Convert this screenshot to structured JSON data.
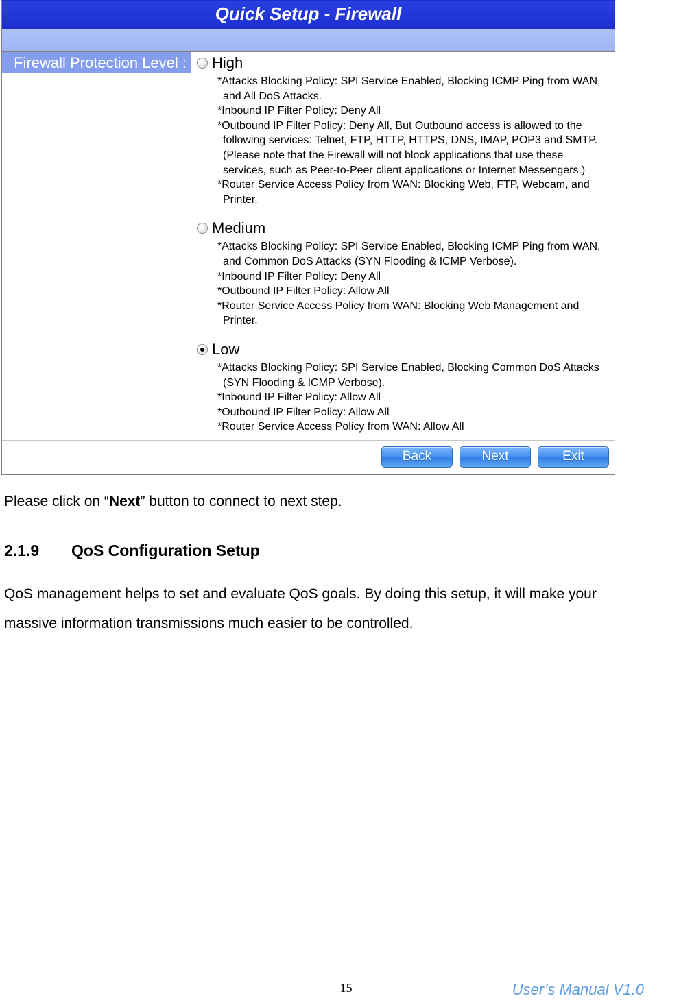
{
  "panel": {
    "title": "Quick Setup - Firewall",
    "label": "Firewall Protection Level :",
    "selected": "low",
    "options": {
      "high": {
        "label": "High",
        "descriptions": [
          "Attacks Blocking Policy: SPI Service Enabled, Blocking ICMP Ping from WAN, and All DoS Attacks.",
          "Inbound IP Filter Policy: Deny All",
          "Outbound IP Filter Policy: Deny All, But Outbound access is allowed to the following services: Telnet, FTP, HTTP, HTTPS, DNS, IMAP, POP3 and SMTP. (Please note that the Firewall will not block applications that use these services, such as Peer-to-Peer client applications or Internet Messengers.)",
          "Router Service Access Policy from WAN: Blocking Web, FTP, Webcam, and Printer."
        ]
      },
      "medium": {
        "label": "Medium",
        "descriptions": [
          "Attacks Blocking Policy: SPI Service Enabled, Blocking ICMP Ping from WAN, and Common DoS Attacks (SYN Flooding & ICMP Verbose).",
          "Inbound IP Filter Policy: Deny All",
          "Outbound IP Filter Policy: Allow All",
          "Router Service Access Policy from WAN: Blocking Web Management and Printer."
        ]
      },
      "low": {
        "label": "Low",
        "descriptions": [
          "Attacks Blocking Policy: SPI Service Enabled, Blocking Common DoS Attacks (SYN Flooding & ICMP Verbose).",
          "Inbound IP Filter Policy: Allow All",
          "Outbound IP Filter Policy: Allow All",
          "Router Service Access Policy from WAN: Allow All"
        ]
      }
    },
    "buttons": {
      "back": "Back",
      "next": "Next",
      "exit": "Exit"
    }
  },
  "doc": {
    "instruction_pre": "Please click on “",
    "instruction_bold": "Next",
    "instruction_post": "” button to connect to next step.",
    "heading_num": "2.1.9",
    "heading_text": "QoS Configuration Setup",
    "paragraph": "QoS management helps to set and evaluate QoS goals. By doing this setup, it will make your massive information transmissions much easier to be controlled."
  },
  "footer": {
    "page_number": "15",
    "manual_label": "User’s Manual V1.0"
  }
}
